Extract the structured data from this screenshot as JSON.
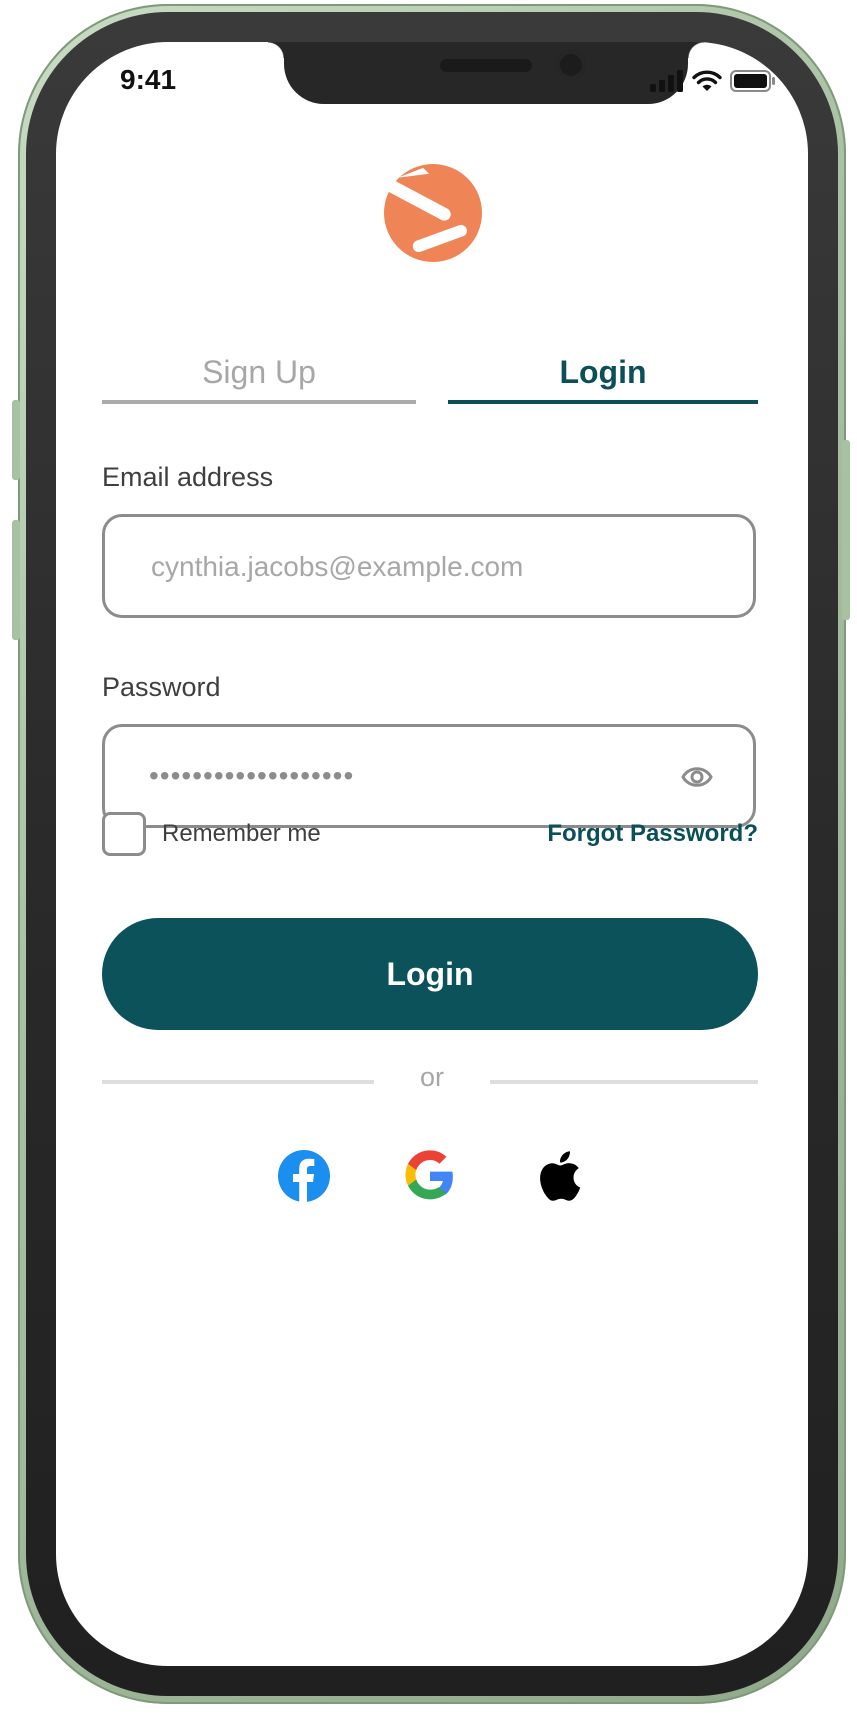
{
  "status_bar": {
    "time": "9:41"
  },
  "tabs": {
    "signup_label": "Sign Up",
    "login_label": "Login"
  },
  "email": {
    "label": "Email address",
    "placeholder": "cynthia.jacobs@example.com"
  },
  "password": {
    "label": "Password",
    "masked_value": "•••••••••••••••••••"
  },
  "remember": {
    "label": "Remember me",
    "checked": false
  },
  "forgot_label": "Forgot Password?",
  "login_button_label": "Login",
  "divider_label": "or",
  "social": [
    "facebook-icon",
    "google-icon",
    "apple-icon"
  ],
  "colors": {
    "primary": "#0b525a",
    "accent": "#ef8556",
    "muted": "#a7a7a7",
    "border": "#8c8c8c"
  }
}
